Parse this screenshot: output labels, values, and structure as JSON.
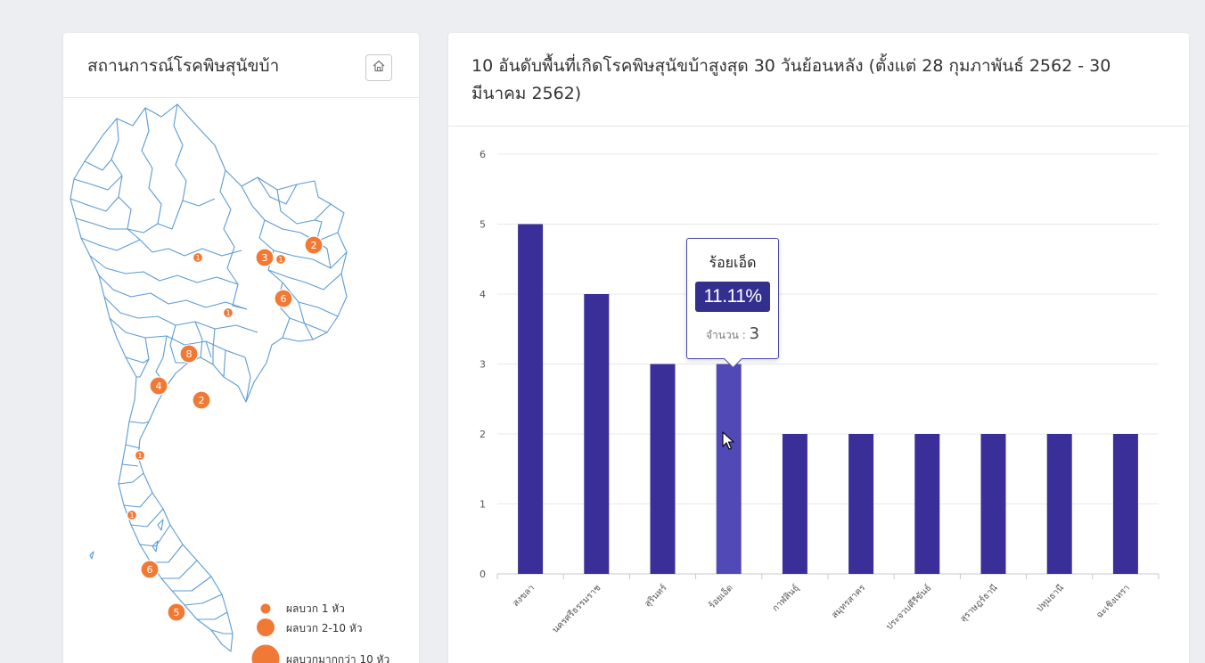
{
  "map_panel": {
    "title": "สถานการณ์โรคพิษสุนัขบ้า",
    "home_icon": "home-icon",
    "markers": [
      {
        "label": "2",
        "size": "medium"
      },
      {
        "label": "3",
        "size": "medium"
      },
      {
        "label": "1",
        "size": "small"
      },
      {
        "label": "1",
        "size": "small"
      },
      {
        "label": "6",
        "size": "medium"
      },
      {
        "label": "1",
        "size": "small"
      },
      {
        "label": "8",
        "size": "medium"
      },
      {
        "label": "4",
        "size": "medium"
      },
      {
        "label": "2",
        "size": "medium"
      },
      {
        "label": "1",
        "size": "small"
      },
      {
        "label": "1",
        "size": "small"
      },
      {
        "label": "6",
        "size": "medium"
      },
      {
        "label": "5",
        "size": "medium"
      }
    ],
    "legend": [
      {
        "label": "ผลบวก 1 หัว"
      },
      {
        "label": "ผลบวก 2-10 หัว"
      },
      {
        "label": "ผลบวกมากกว่า 10 หัว"
      }
    ],
    "marker_color": "#f07a35",
    "border_color": "#5b9bd5"
  },
  "chart_panel": {
    "title": "10 อันดับพื้นที่เกิดโรคพิษสุนัขบ้าสูงสุด 30 วันย้อนหลัง (ตั้งแต่ 28 กุมภาพันธ์ 2562 - 30 มีนาคม 2562)",
    "tooltip": {
      "name": "ร้อยเอ็ด",
      "percent": "11.11%",
      "count_label": "จำนวน :",
      "count_value": "3"
    }
  },
  "chart_data": {
    "type": "bar",
    "title": "10 อันดับพื้นที่เกิดโรคพิษสุนัขบ้าสูงสุด 30 วันย้อนหลัง (ตั้งแต่ 28 กุมภาพันธ์ 2562 - 30 มีนาคม 2562)",
    "categories": [
      "สงขลา",
      "นครศรีธรรมราช",
      "สุรินทร์",
      "ร้อยเอ็ด",
      "กาฬสินธุ์",
      "สมุทรสาคร",
      "ประจวบคีรีขันธ์",
      "สุราษฎร์ธานี",
      "ปทุมธานี",
      "ฉะเชิงเทรา"
    ],
    "values": [
      5,
      4,
      3,
      3,
      2,
      2,
      2,
      2,
      2,
      2
    ],
    "ylim": [
      0,
      6
    ],
    "yticks": [
      "0",
      "1",
      "2",
      "3",
      "4",
      "5",
      "6"
    ],
    "highlight_index": 3,
    "bar_color": "#3a2f98",
    "highlight_color": "#5149b5",
    "grid": true
  }
}
